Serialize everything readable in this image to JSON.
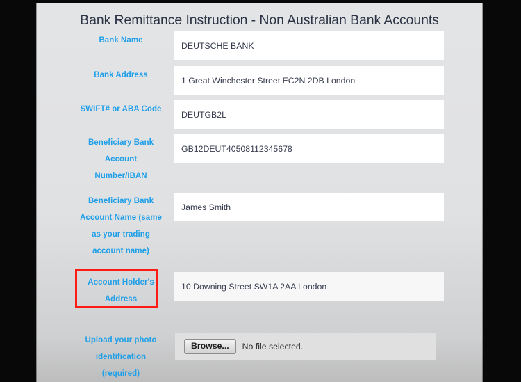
{
  "page": {
    "title": "Bank Remittance Instruction - Non Australian Bank Accounts",
    "accent_blue": "#1F9FE8",
    "title_color": "#2c3345",
    "highlight_color": "#FF1A14",
    "panel_background": "#e0e1e3"
  },
  "fields": [
    {
      "name": "bank-name",
      "label_lines": [
        "Bank Name"
      ],
      "value": "DEUTSCHE BANK",
      "tinted": false
    },
    {
      "name": "bank-address",
      "label_lines": [
        "Bank Address"
      ],
      "value": "1 Great Winchester Street EC2N 2DB London",
      "tinted": false
    },
    {
      "name": "swift-aba-code",
      "label_lines": [
        "SWIFT# or ABA Code"
      ],
      "value": "DEUTGB2L",
      "tinted": false
    },
    {
      "name": "beneficiary-account-number",
      "label_lines": [
        "Beneficiary Bank",
        "Account",
        "Number/IBAN"
      ],
      "value": "GB12DEUT40508112345678",
      "tinted": false
    },
    {
      "name": "beneficiary-account-name",
      "label_lines": [
        "Beneficiary Bank",
        "Account Name (same",
        "as your trading",
        "account name)"
      ],
      "value": "James Smith",
      "tinted": false
    },
    {
      "name": "account-holder-address",
      "label_lines": [
        "Account Holder's",
        "Address"
      ],
      "value": "10 Downing Street SW1A 2AA London",
      "tinted": true
    }
  ],
  "upload": {
    "label_lines": [
      "Upload your photo",
      "identification",
      "(required)"
    ],
    "browse_label": "Browse...",
    "status_text": "No file selected."
  },
  "annotation": {
    "name": "account-holder-address-highlight",
    "color": "#FF1A14"
  }
}
